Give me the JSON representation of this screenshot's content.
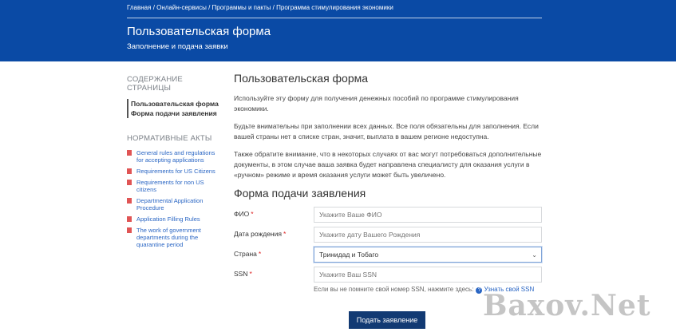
{
  "header": {
    "breadcrumb": [
      "Главная",
      "Онлайн-сервисы",
      "Программы и пакты",
      "Программа стимулирования экономики"
    ],
    "title": "Пользовательская форма",
    "subtitle": "Заполнение и подача заявки"
  },
  "sidebar": {
    "toc_heading": "СОДЕРЖАНИЕ СТРАНИЦЫ",
    "toc_items": [
      "Пользовательская форма",
      "Форма подачи заявления"
    ],
    "acts_heading": "НОРМАТИВНЫЕ АКТЫ",
    "acts": [
      "General rules and regulations for accepting applications",
      "Requirements for US Citizens",
      "Requirements for non US citizens",
      "Departmental Application Procedure",
      "Application Filling Rules",
      "The work of government departments during the quarantine period"
    ]
  },
  "main": {
    "title": "Пользовательская форма",
    "paragraphs": [
      "Используйте эту форму для получения денежных пособий по программе стимулирования экономики.",
      "Будьте внимательны при заполнении всех данных. Все поля обязательны для заполнения. Если вашей страны нет в списке стран, значит, выплата в вашем регионе недоступна.",
      "Также обратите внимание, что в некоторых случаях от вас могут потребоваться дополнительные документы, в этом случае ваша заявка будет направлена специалисту для оказания услуги в «ручном» режиме и время оказания услуги может быть увеличено."
    ]
  },
  "form": {
    "title": "Форма подачи заявления",
    "required_mark": "*",
    "fio_label": "ФИО",
    "fio_placeholder": "Укажите Ваше ФИО",
    "birth_label": "Дата рождения",
    "birth_placeholder": "Укажите дату Вашего Рождения",
    "country_label": "Страна",
    "country_value": "Тринидад и Тобаго",
    "ssn_label": "SSN",
    "ssn_placeholder": "Укажите Ваш SSN",
    "hint_text": "Если вы не помните свой номер SSN, нажмите здесь:",
    "hint_icon": "?",
    "hint_link": "Узнать свой SSN",
    "submit_label": "Подать заявление"
  },
  "watermark": "Baxov.Net",
  "colors": {
    "header_bg": "#0a4aa5",
    "link": "#2a66c4",
    "button_bg": "#123a73",
    "required": "#dd2222"
  }
}
